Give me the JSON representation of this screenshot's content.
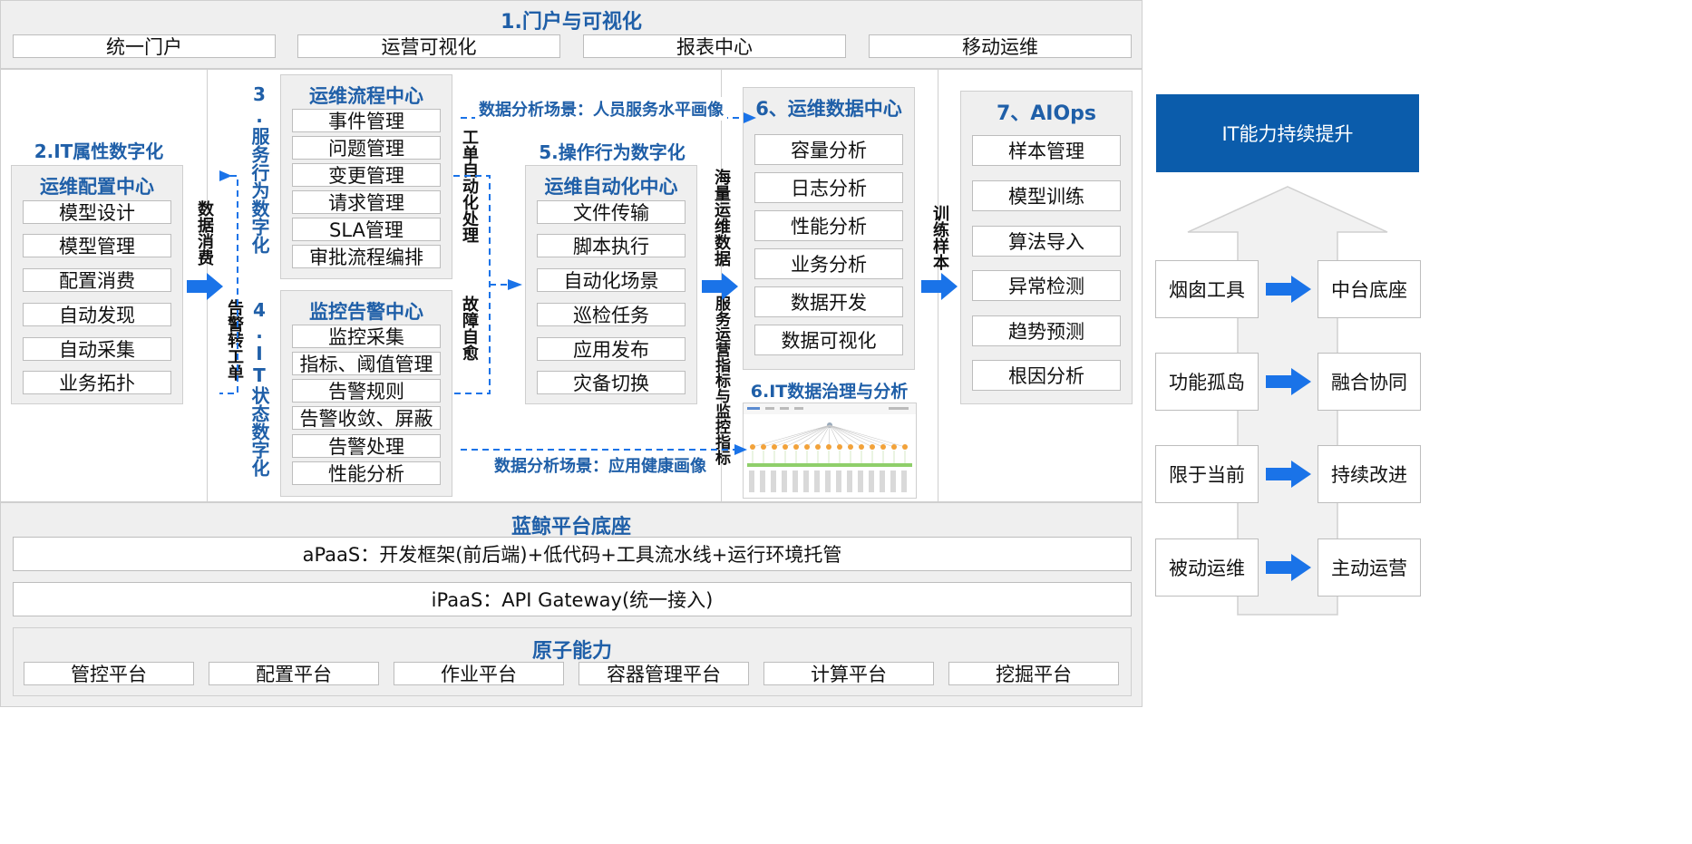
{
  "portal": {
    "title": "1.门户与可视化",
    "items": [
      "统一门户",
      "运营可视化",
      "报表中心",
      "移动运维"
    ]
  },
  "it_attr": {
    "title": "2.IT属性数字化",
    "center_title": "运维配置中心",
    "items": [
      "模型设计",
      "模型管理",
      "配置消费",
      "自动发现",
      "自动采集",
      "业务拓扑"
    ]
  },
  "labels": {
    "data_consume": "数据消费",
    "alarm_ticket": "告警转工单",
    "service_behavior": "3.服务行为数字化",
    "it_status": "4.IT状态数字化",
    "ticket_auto": "工单自动化处理",
    "self_heal": "故障自愈",
    "massive_data": "海量运维数据",
    "service_metrics": "服务运营指标与监控指标",
    "train_samples": "训练样本",
    "scene_people": "数据分析场景：人员服务水平画像",
    "scene_app": "数据分析场景：应用健康画像"
  },
  "process_center": {
    "title": "运维流程中心",
    "items": [
      "事件管理",
      "问题管理",
      "变更管理",
      "请求管理",
      "SLA管理",
      "审批流程编排"
    ]
  },
  "monitor_center": {
    "title": "监控告警中心",
    "items": [
      "监控采集",
      "指标、阈值管理",
      "告警规则",
      "告警收敛、屏蔽",
      "告警处理",
      "性能分析"
    ]
  },
  "automation": {
    "title": "5.操作行为数字化",
    "center_title": "运维自动化中心",
    "items": [
      "文件传输",
      "脚本执行",
      "自动化场景",
      "巡检任务",
      "应用发布",
      "灾备切换"
    ]
  },
  "data_center": {
    "title": "6、运维数据中心",
    "items": [
      "容量分析",
      "日志分析",
      "性能分析",
      "业务分析",
      "数据开发",
      "数据可视化"
    ],
    "governance_title": "6.IT数据治理与分析"
  },
  "aiops": {
    "title": "7、AIOps",
    "items": [
      "样本管理",
      "模型训练",
      "算法导入",
      "异常检测",
      "趋势预测",
      "根因分析"
    ]
  },
  "platform": {
    "title": "蓝鲸平台底座",
    "apaas": "aPaaS：开发框架(前后端)+低代码+工具流水线+运行环境托管",
    "ipaas": "iPaaS：API Gateway(统一接入)",
    "atomic_title": "原子能力",
    "atomic_items": [
      "管控平台",
      "配置平台",
      "作业平台",
      "容器管理平台",
      "计算平台",
      "挖掘平台"
    ]
  },
  "improvement": {
    "header": "IT能力持续提升",
    "pairs": [
      {
        "from": "烟囱工具",
        "to": "中台底座"
      },
      {
        "from": "功能孤岛",
        "to": "融合协同"
      },
      {
        "from": "限于当前",
        "to": "持续改进"
      },
      {
        "from": "被动运维",
        "to": "主动运营"
      }
    ]
  },
  "colors": {
    "accent": "#1f5fa8",
    "arrow": "#1a73e8",
    "header_bg": "#0b5cab",
    "panel_bg": "#efefef"
  }
}
